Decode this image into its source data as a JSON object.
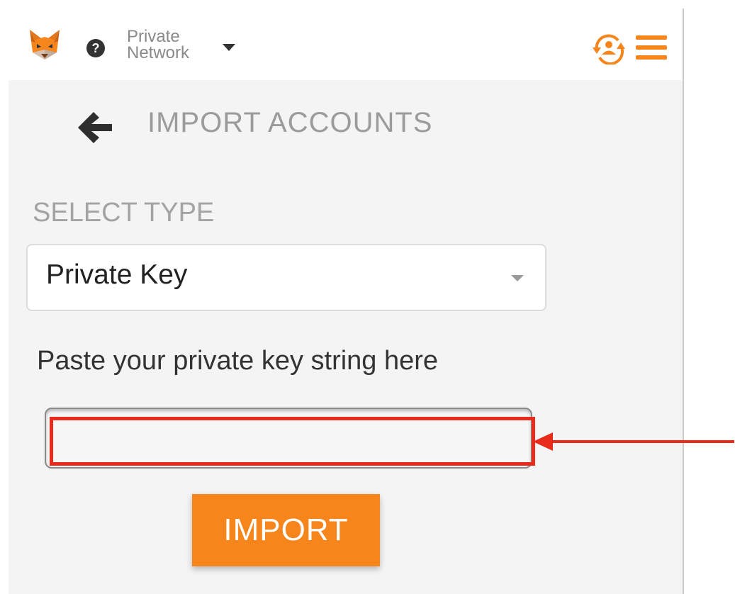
{
  "header": {
    "network": {
      "line1": "Private",
      "line2": "Network"
    },
    "help_icon": "?",
    "icons": {
      "logo": "metamask-fox-icon",
      "help": "question-circle-icon",
      "account": "account-switch-icon",
      "menu": "hamburger-menu-icon"
    }
  },
  "page": {
    "title": "IMPORT ACCOUNTS",
    "back_icon": "arrow-left-icon"
  },
  "form": {
    "select_label": "SELECT TYPE",
    "selected_type": "Private Key",
    "input_label": "Paste your private key string here",
    "input_value": "",
    "import_label": "IMPORT"
  },
  "colors": {
    "accent": "#f6851b",
    "annotation": "#e82b1b",
    "muted_text": "#9b9b9b",
    "panel_bg": "#f4f4f4"
  }
}
